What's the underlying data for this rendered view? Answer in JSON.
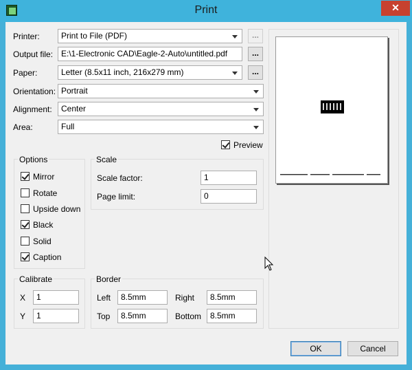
{
  "window": {
    "title": "Print",
    "close_glyph": "✕"
  },
  "printer": {
    "label": "Printer:",
    "value": "Print to File (PDF)",
    "button": "..."
  },
  "output_file": {
    "label": "Output file:",
    "value": "E:\\1-Electronic CAD\\Eagle-2-Auto\\untitled.pdf",
    "button": "..."
  },
  "paper": {
    "label": "Paper:",
    "value": "Letter (8.5x11 inch, 216x279 mm)",
    "button": "..."
  },
  "orientation": {
    "label": "Orientation:",
    "value": "Portrait"
  },
  "alignment": {
    "label": "Alignment:",
    "value": "Center"
  },
  "area": {
    "label": "Area:",
    "value": "Full"
  },
  "preview": {
    "label": "Preview",
    "checked": true
  },
  "options": {
    "title": "Options",
    "items": [
      {
        "label": "Mirror",
        "checked": true
      },
      {
        "label": "Rotate",
        "checked": false
      },
      {
        "label": "Upside down",
        "checked": false
      },
      {
        "label": "Black",
        "checked": true
      },
      {
        "label": "Solid",
        "checked": false
      },
      {
        "label": "Caption",
        "checked": true
      }
    ]
  },
  "scale": {
    "title": "Scale",
    "factor_label": "Scale factor:",
    "factor_value": "1",
    "limit_label": "Page limit:",
    "limit_value": "0"
  },
  "calibrate": {
    "title": "Calibrate",
    "x_label": "X",
    "x_value": "1",
    "y_label": "Y",
    "y_value": "1"
  },
  "border": {
    "title": "Border",
    "left_label": "Left",
    "left_value": "8.5mm",
    "right_label": "Right",
    "right_value": "8.5mm",
    "top_label": "Top",
    "top_value": "8.5mm",
    "bottom_label": "Bottom",
    "bottom_value": "8.5mm"
  },
  "buttons": {
    "ok": "OK",
    "cancel": "Cancel"
  },
  "colors": {
    "titlebar": "#3fb3dc",
    "close": "#c7412f",
    "dialog": "#f0f0f0"
  }
}
